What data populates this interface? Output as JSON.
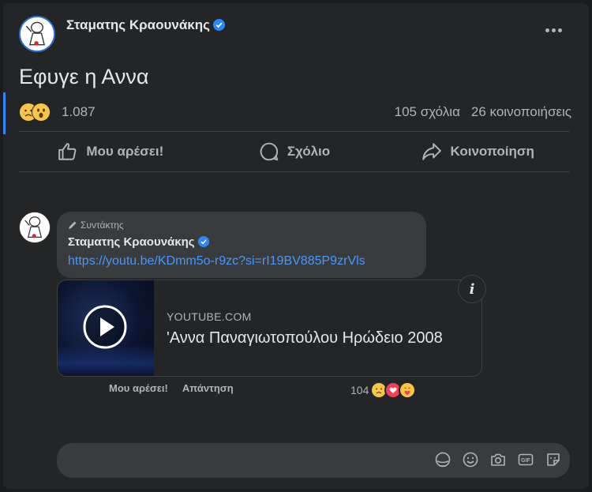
{
  "post": {
    "author": "Σταματης Κραουνάκης",
    "text": "Εφυγε η Αννα",
    "reaction_count": "1.087",
    "reaction_icons": [
      "sad-emoji",
      "wow-emoji"
    ],
    "comments": "105 σχόλια",
    "shares": "26 κοινοποιήσεις",
    "actions": {
      "like": "Μου αρέσει!",
      "comment": "Σχόλιο",
      "share": "Κοινοποίηση"
    }
  },
  "comment": {
    "role": "Συντάκτης",
    "author": "Σταματης Κραουνάκης",
    "link": "https://youtu.be/KDmm5o-r9zc?si=rI19BV885P9zrVls",
    "card": {
      "domain": "YOUTUBE.COM",
      "title": "'Αννα Παναγιωτοπούλου Ηρώδειο 2008"
    },
    "like_label": "Μου αρέσει!",
    "reply_label": "Απάντηση",
    "reaction_count": "104",
    "reaction_icons": [
      "sad-emoji",
      "love-emoji",
      "care-emoji"
    ]
  },
  "composer": {
    "placeholder": "",
    "tools": [
      "avatar-sticker-icon",
      "emoji-icon",
      "camera-icon",
      "gif-icon",
      "sticker-icon"
    ]
  },
  "colors": {
    "background": "#242526",
    "bubble": "#3a3b3c",
    "link": "#4599ff",
    "verified": "#2d88ff"
  }
}
